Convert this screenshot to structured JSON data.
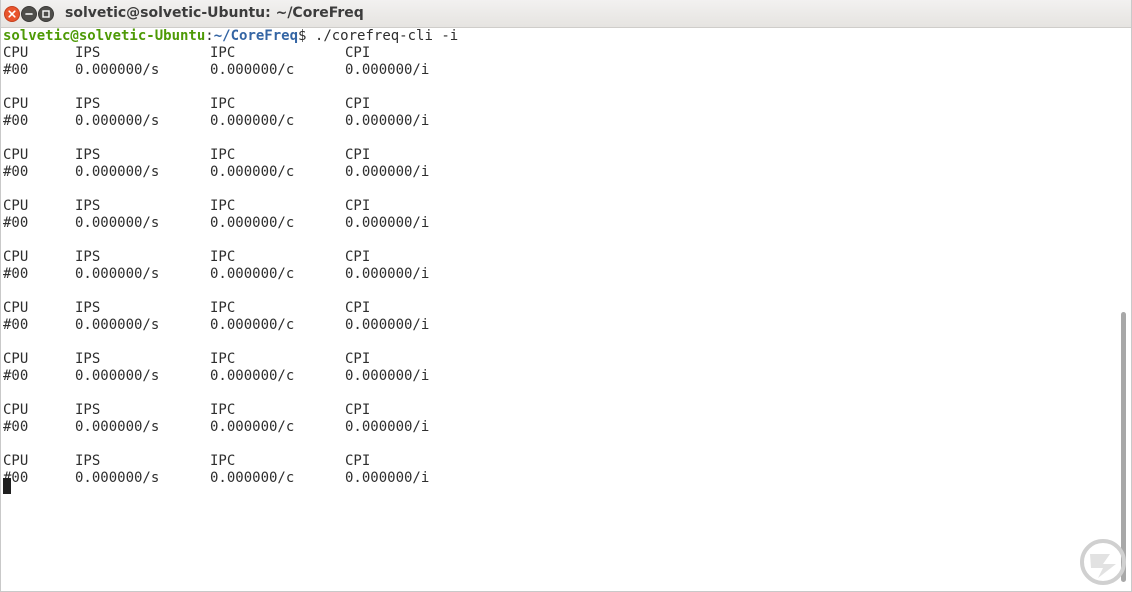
{
  "window": {
    "title": "solvetic@solvetic-Ubuntu: ~/CoreFreq",
    "controls": [
      "close-icon",
      "minimize-icon",
      "maximize-icon"
    ]
  },
  "terminal": {
    "prompt_user_host": "solvetic@solvetic-Ubuntu",
    "prompt_colon": ":",
    "prompt_path": "~/CoreFreq",
    "prompt_symbol": "$ ",
    "command": "./corefreq-cli -i",
    "blocks": [
      {
        "header": [
          "CPU",
          "IPS",
          "IPC",
          "CPI"
        ],
        "values": [
          "#00",
          "0.000000/s",
          "0.000000/c",
          "0.000000/i"
        ]
      },
      {
        "header": [
          "CPU",
          "IPS",
          "IPC",
          "CPI"
        ],
        "values": [
          "#00",
          "0.000000/s",
          "0.000000/c",
          "0.000000/i"
        ]
      },
      {
        "header": [
          "CPU",
          "IPS",
          "IPC",
          "CPI"
        ],
        "values": [
          "#00",
          "0.000000/s",
          "0.000000/c",
          "0.000000/i"
        ]
      },
      {
        "header": [
          "CPU",
          "IPS",
          "IPC",
          "CPI"
        ],
        "values": [
          "#00",
          "0.000000/s",
          "0.000000/c",
          "0.000000/i"
        ]
      },
      {
        "header": [
          "CPU",
          "IPS",
          "IPC",
          "CPI"
        ],
        "values": [
          "#00",
          "0.000000/s",
          "0.000000/c",
          "0.000000/i"
        ]
      },
      {
        "header": [
          "CPU",
          "IPS",
          "IPC",
          "CPI"
        ],
        "values": [
          "#00",
          "0.000000/s",
          "0.000000/c",
          "0.000000/i"
        ]
      },
      {
        "header": [
          "CPU",
          "IPS",
          "IPC",
          "CPI"
        ],
        "values": [
          "#00",
          "0.000000/s",
          "0.000000/c",
          "0.000000/i"
        ]
      },
      {
        "header": [
          "CPU",
          "IPS",
          "IPC",
          "CPI"
        ],
        "values": [
          "#00",
          "0.000000/s",
          "0.000000/c",
          "0.000000/i"
        ]
      },
      {
        "header": [
          "CPU",
          "IPS",
          "IPC",
          "CPI"
        ],
        "values": [
          "#00",
          "0.000000/s",
          "0.000000/c",
          "0.000000/i"
        ]
      }
    ]
  },
  "colors": {
    "prompt_user": "#4e9a06",
    "prompt_path": "#3465a4",
    "close_button": "#e9542c",
    "text": "#2e2e2e"
  },
  "watermark": {
    "icon": "solvetic-logo-icon"
  }
}
